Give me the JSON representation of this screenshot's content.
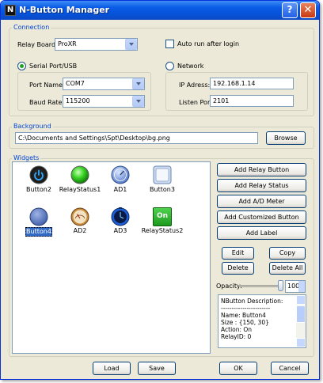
{
  "window": {
    "title": "N-Button Manager",
    "icon_text": "N"
  },
  "titlebar": {
    "help": "?",
    "close": "✕"
  },
  "connection": {
    "legend": "Connection",
    "relay_board_label": "Relay Board:",
    "relay_board_value": "ProXR",
    "auto_run_label": "Auto run after login",
    "serial_label": "Serial Port/USB",
    "network_label": "Network",
    "port_name_label": "Port Name:",
    "port_name_value": "COM7",
    "baud_rate_label": "Baud Rate:",
    "baud_rate_value": "115200",
    "ip_label": "IP Adress:",
    "ip_value": "192.168.1.14",
    "listen_label": "Listen Port:",
    "listen_value": "2101"
  },
  "background": {
    "legend": "Background",
    "path": "C:\\Documents and Settings\\Spt\\Desktop\\bg.png",
    "browse": "Browse"
  },
  "widgets": {
    "legend": "Widgets",
    "items": [
      {
        "label": "Button2",
        "icon": "power-button-icon"
      },
      {
        "label": "RelayStatus1",
        "icon": "green-led-icon"
      },
      {
        "label": "AD1",
        "icon": "analog-meter-icon"
      },
      {
        "label": "Button3",
        "icon": "square-button-icon"
      },
      {
        "label": "Button4",
        "icon": "round-blue-button-icon"
      },
      {
        "label": "AD2",
        "icon": "gauge-icon"
      },
      {
        "label": "AD3",
        "icon": "clock-meter-icon"
      },
      {
        "label": "RelayStatus2",
        "icon": "on-indicator-icon"
      }
    ],
    "on_text": "On"
  },
  "actions": {
    "add_relay_button": "Add Relay Button",
    "add_relay_status": "Add Relay Status",
    "add_ad_meter": "Add A/D Meter",
    "add_customized": "Add Customized Button",
    "add_label": "Add Label",
    "edit": "Edit",
    "copy": "Copy",
    "delete": "Delete",
    "delete_all": "Delete All"
  },
  "opacity": {
    "label": "Opacity:",
    "value": "100",
    "level": 1.0
  },
  "description": [
    "NButton Description:",
    "-----------------------",
    "Name: Button4",
    "Size : {150, 30}",
    "Action: On",
    "RelayID: 0"
  ],
  "footer": {
    "load": "Load",
    "save": "Save",
    "ok": "OK",
    "cancel": "Cancel"
  }
}
